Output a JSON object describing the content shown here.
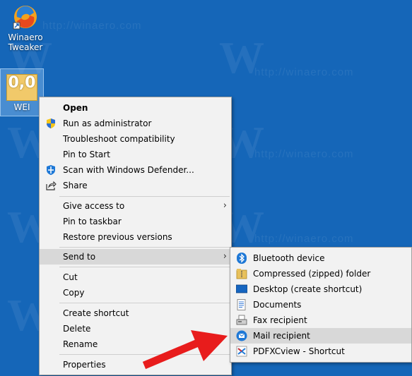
{
  "watermark": "http://winaero.com",
  "desktop": {
    "icons": [
      {
        "label_line1": "Winaero",
        "label_line2": "Tweaker"
      },
      {
        "tile_text": "0,0",
        "label": "WEI"
      }
    ]
  },
  "context_menu": {
    "items": [
      {
        "label": "Open"
      },
      {
        "label": "Run as administrator"
      },
      {
        "label": "Troubleshoot compatibility"
      },
      {
        "label": "Pin to Start"
      },
      {
        "label": "Scan with Windows Defender..."
      },
      {
        "label": "Share"
      },
      {
        "label": "Give access to"
      },
      {
        "label": "Pin to taskbar"
      },
      {
        "label": "Restore previous versions"
      },
      {
        "label": "Send to"
      },
      {
        "label": "Cut"
      },
      {
        "label": "Copy"
      },
      {
        "label": "Create shortcut"
      },
      {
        "label": "Delete"
      },
      {
        "label": "Rename"
      },
      {
        "label": "Properties"
      }
    ]
  },
  "send_to_menu": {
    "items": [
      {
        "label": "Bluetooth device",
        "icon": "bluetooth-icon"
      },
      {
        "label": "Compressed (zipped) folder",
        "icon": "zip-folder-icon"
      },
      {
        "label": "Desktop (create shortcut)",
        "icon": "desktop-icon"
      },
      {
        "label": "Documents",
        "icon": "documents-icon"
      },
      {
        "label": "Fax recipient",
        "icon": "fax-icon"
      },
      {
        "label": "Mail recipient",
        "icon": "mail-icon"
      },
      {
        "label": "PDFXCview - Shortcut",
        "icon": "pdfxcview-icon"
      }
    ]
  },
  "colors": {
    "desktop": "#1566b8",
    "menu_bg": "#f2f2f2",
    "highlight": "#d8d8d8",
    "arrow": "#e81c1c"
  }
}
